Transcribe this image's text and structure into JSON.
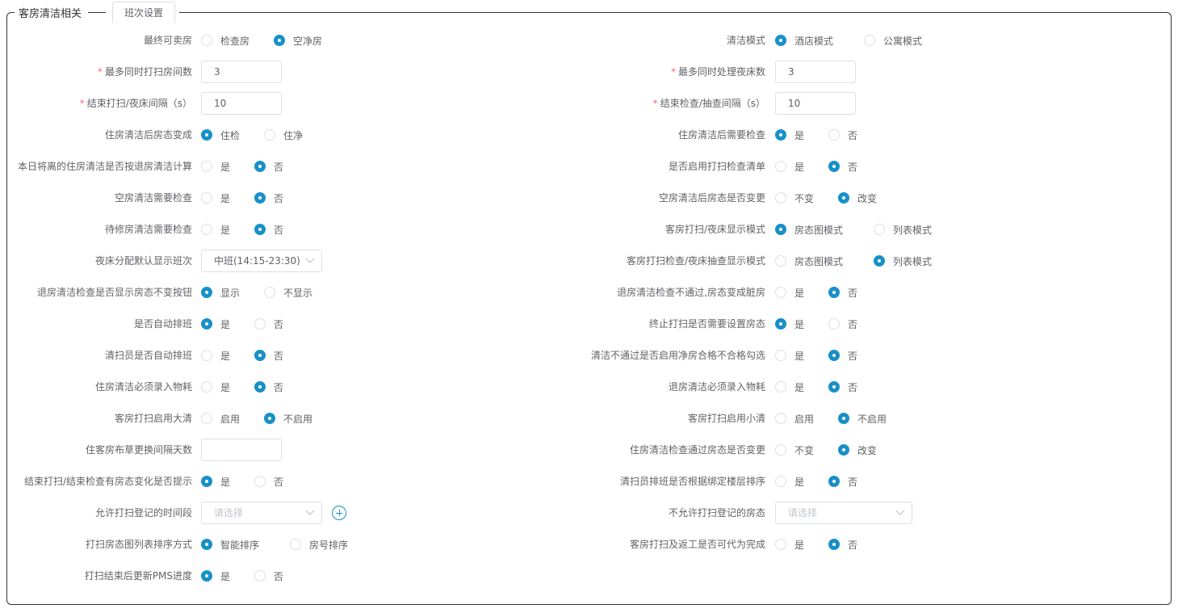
{
  "panel": {
    "title": "客房清洁相关",
    "tab_label": "班次设置"
  },
  "left": [
    {
      "label": "最终可卖房",
      "type": "radio",
      "options": [
        "检查房",
        "空净房"
      ],
      "selected": 1
    },
    {
      "label": "最多同时打扫房间数",
      "required": true,
      "type": "input",
      "value": "3"
    },
    {
      "label": "结束打扫/夜床间隔（s）",
      "required": true,
      "type": "input",
      "value": "10"
    },
    {
      "label": "住房清洁后房态变成",
      "type": "radio",
      "options": [
        "住检",
        "住净"
      ],
      "selected": 0
    },
    {
      "label": "本日将离的住房清洁是否按退房清洁计算",
      "type": "radio",
      "options": [
        "是",
        "否"
      ],
      "selected": 1
    },
    {
      "label": "空房清洁需要检查",
      "type": "radio",
      "options": [
        "是",
        "否"
      ],
      "selected": 1
    },
    {
      "label": "待修房清洁需要检查",
      "type": "radio",
      "options": [
        "是",
        "否"
      ],
      "selected": 1
    },
    {
      "label": "夜床分配默认显示班次",
      "type": "select",
      "value": "中班(14:15-23:30)"
    },
    {
      "label": "退房清洁检查是否显示房态不变按钮",
      "type": "radio",
      "options": [
        "显示",
        "不显示"
      ],
      "selected": 0
    },
    {
      "label": "是否自动排班",
      "type": "radio",
      "options": [
        "是",
        "否"
      ],
      "selected": 0
    },
    {
      "label": "清扫员是否自动排班",
      "type": "radio",
      "options": [
        "是",
        "否"
      ],
      "selected": 1
    },
    {
      "label": "住房清洁必须录入物耗",
      "type": "radio",
      "options": [
        "是",
        "否"
      ],
      "selected": 1
    },
    {
      "label": "客房打扫启用大清",
      "type": "radio",
      "options": [
        "启用",
        "不启用"
      ],
      "selected": 1
    },
    {
      "label": "住客房布草更换间隔天数",
      "type": "input",
      "value": ""
    },
    {
      "label": "结束打扫/结束检查有房态变化是否提示",
      "type": "radio",
      "options": [
        "是",
        "否"
      ],
      "selected": 0
    },
    {
      "label": "允许打扫登记的时间段",
      "type": "select-add",
      "placeholder": "请选择"
    },
    {
      "label": "打扫房态图列表排序方式",
      "type": "radio",
      "options": [
        "智能排序",
        "房号排序"
      ],
      "selected": 0
    },
    {
      "label": "打扫结束后更新PMS进度",
      "type": "radio",
      "options": [
        "是",
        "否"
      ],
      "selected": 0
    }
  ],
  "right": [
    {
      "label": "清洁模式",
      "type": "radio",
      "options": [
        "酒店模式",
        "公寓模式"
      ],
      "selected": 0
    },
    {
      "label": "最多同时处理夜床数",
      "required": true,
      "type": "input",
      "value": "3"
    },
    {
      "label": "结束检查/抽查间隔（s）",
      "required": true,
      "type": "input",
      "value": "10"
    },
    {
      "label": "住房清洁后需要检查",
      "type": "radio",
      "options": [
        "是",
        "否"
      ],
      "selected": 0
    },
    {
      "label": "是否启用打扫检查清单",
      "type": "radio",
      "options": [
        "是",
        "否"
      ],
      "selected": 1
    },
    {
      "label": "空房清洁后房态是否变更",
      "type": "radio",
      "options": [
        "不变",
        "改变"
      ],
      "selected": 1
    },
    {
      "label": "客房打扫/夜床显示模式",
      "type": "radio",
      "options": [
        "房态图模式",
        "列表模式"
      ],
      "selected": 0
    },
    {
      "label": "客房打扫检查/夜床抽查显示模式",
      "type": "radio",
      "options": [
        "房态图模式",
        "列表模式"
      ],
      "selected": 1
    },
    {
      "label": "退房清洁检查不通过,房态变成脏房",
      "type": "radio",
      "options": [
        "是",
        "否"
      ],
      "selected": 1
    },
    {
      "label": "终止打扫是否需要设置房态",
      "type": "radio",
      "options": [
        "是",
        "否"
      ],
      "selected": 0
    },
    {
      "label": "清洁不通过是否启用净房合格不合格勾选",
      "type": "radio",
      "options": [
        "是",
        "否"
      ],
      "selected": 1
    },
    {
      "label": "退房清洁必须录入物耗",
      "type": "radio",
      "options": [
        "是",
        "否"
      ],
      "selected": 1
    },
    {
      "label": "客房打扫启用小清",
      "type": "radio",
      "options": [
        "启用",
        "不启用"
      ],
      "selected": 1
    },
    {
      "label": "住房清洁检查通过房态是否变更",
      "type": "radio",
      "options": [
        "不变",
        "改变"
      ],
      "selected": 1
    },
    {
      "label": "清扫员排班是否根据绑定楼层排序",
      "type": "radio",
      "options": [
        "是",
        "否"
      ],
      "selected": 1
    },
    {
      "label": "不允许打扫登记的房态",
      "type": "select-wide",
      "placeholder": "请选择"
    },
    {
      "label": "客房打扫及返工是否可代为完成",
      "type": "radio",
      "options": [
        "是",
        "否"
      ],
      "selected": 1
    }
  ],
  "colors": {
    "accent": "#1890c8",
    "required": "#f56c6c",
    "border": "#dcdfe6"
  },
  "icons": {
    "dropdown": "chevron-down-icon",
    "add": "plus-circle-icon"
  }
}
